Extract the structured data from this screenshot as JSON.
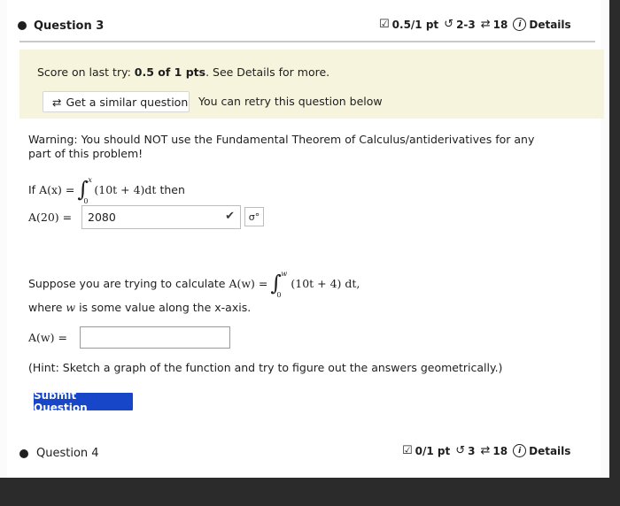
{
  "question": {
    "title": "Question 3",
    "score": "0.5/1 pt",
    "attempts": "2-3",
    "retries": "18",
    "details_label": "Details"
  },
  "score_panel": {
    "prefix": "Score on last try: ",
    "score": "0.5 of 1 pts",
    "suffix": ". See Details for more.",
    "similar_button": "Get a similar question",
    "retry_text": "You can retry this question below"
  },
  "problem": {
    "warning": "Warning: You should NOT use the Fundamental Theorem of Calculus/antiderivatives for any part of this problem!",
    "if_label": "If",
    "def_lhs": "A(x) =",
    "integrand": "(10t + 4)dt",
    "upper_limit": "x",
    "lower_limit": "0",
    "then_label": "then",
    "answer_lhs": "A(20) =",
    "answer_value": "2080",
    "sigma_label": "σ°",
    "suppose_text": "Suppose you are trying to calculate",
    "suppose_lhs": "A(w) =",
    "suppose_integrand": "(10t + 4) dt,",
    "suppose_upper": "w",
    "suppose_lower": "0",
    "where_text": "where",
    "where_var": "w",
    "where_rest": "is some value along the x-axis.",
    "aw_lhs": "A(w) =",
    "aw_value": "",
    "hint": "(Hint: Sketch a graph of the function and try to figure out the answers geometrically.)",
    "submit_label": "Submit Question"
  },
  "next_question": {
    "title": "Question 4",
    "score": "0/1 pt",
    "attempts": "3",
    "retries": "18",
    "details_label": "Details"
  }
}
